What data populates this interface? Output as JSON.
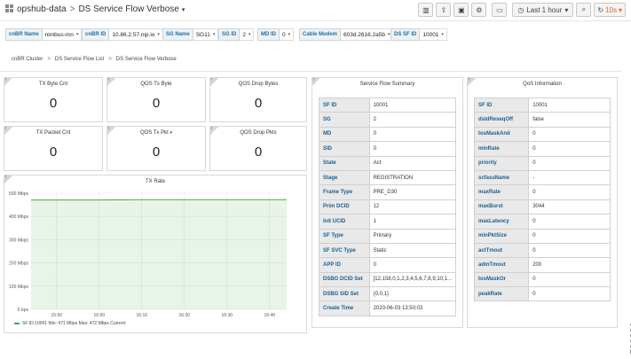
{
  "header": {
    "folder": "opshub-data",
    "dashboard": "DS Service Flow Verbose",
    "tools": [
      {
        "name": "add-panel-icon",
        "glyph": "▥"
      },
      {
        "name": "share-icon",
        "glyph": "⇪"
      },
      {
        "name": "save-icon",
        "glyph": "▣"
      },
      {
        "name": "settings-icon",
        "glyph": "⚙"
      },
      {
        "name": "tv-mode-icon",
        "glyph": "▭"
      }
    ],
    "time_range": "Last 1 hour",
    "refresh": "10s"
  },
  "variables": [
    {
      "label": "cnBR Name",
      "value": "nimbus-mn"
    },
    {
      "label": "cnBR ID",
      "value": "10.86.2.57.nip.io"
    },
    {
      "label": "SG Name",
      "value": "SG11"
    },
    {
      "label": "SG ID",
      "value": "2"
    },
    {
      "label": "MD ID",
      "value": "0"
    },
    {
      "label": "Cable Modem",
      "value": "603d.2616.2a5b"
    },
    {
      "label": "DS SF ID",
      "value": "10001"
    }
  ],
  "links": [
    "cnBR Cluster",
    "DS Service Flow List",
    "DS Service Flow Verbose"
  ],
  "stats": [
    {
      "title": "TX Byte Cnt",
      "value": "0",
      "has_menu": false
    },
    {
      "title": "QOS Tx Byte",
      "value": "0",
      "has_menu": false
    },
    {
      "title": "QOS Drop Bytes",
      "value": "0",
      "has_menu": false
    },
    {
      "title": "TX Packet Cnt",
      "value": "0",
      "has_menu": false
    },
    {
      "title": "QOS Tx Pkt",
      "value": "0",
      "has_menu": true
    },
    {
      "title": "QOS Drop Pkts",
      "value": "0",
      "has_menu": false
    }
  ],
  "summary": {
    "title": "Service Flow Summary",
    "rows": [
      {
        "k": "SF ID",
        "v": "10001"
      },
      {
        "k": "SG",
        "v": "2"
      },
      {
        "k": "MD",
        "v": "0"
      },
      {
        "k": "SID",
        "v": "0"
      },
      {
        "k": "State",
        "v": "Act"
      },
      {
        "k": "Stage",
        "v": "REGISTRATION"
      },
      {
        "k": "Frame Type",
        "v": "PRE_D30"
      },
      {
        "k": "Prim DCID",
        "v": "12"
      },
      {
        "k": "Init UCID",
        "v": "1"
      },
      {
        "k": "SF Type",
        "v": "Primary"
      },
      {
        "k": "SF SVC Type",
        "v": "Static"
      },
      {
        "k": "APP ID",
        "v": "0"
      },
      {
        "k": "DSBG DCID Set",
        "v": "[12,158,0,1,2,3,4,5,6,7,8,9,10,1..."
      },
      {
        "k": "DSBG SID Set",
        "v": "{0,0,1}"
      },
      {
        "k": "Create Time",
        "v": "2020-06-03 13:50:03"
      }
    ]
  },
  "qos": {
    "title": "QoS Information",
    "rows": [
      {
        "k": "SF ID",
        "v": "10001"
      },
      {
        "k": "dsIdReseqOff",
        "v": "false"
      },
      {
        "k": "tosMaskAnd",
        "v": "0"
      },
      {
        "k": "minRate",
        "v": "0"
      },
      {
        "k": "priority",
        "v": "0"
      },
      {
        "k": "scfassName",
        "v": "-"
      },
      {
        "k": "maxRate",
        "v": "0"
      },
      {
        "k": "maxBurst",
        "v": "3044"
      },
      {
        "k": "maxLatency",
        "v": "0"
      },
      {
        "k": "minPktSize",
        "v": "0"
      },
      {
        "k": "actTmout",
        "v": "0"
      },
      {
        "k": "admTmout",
        "v": "200"
      },
      {
        "k": "tosMaskOr",
        "v": "0"
      },
      {
        "k": "peakRate",
        "v": "0"
      }
    ]
  },
  "info_glyph": "i",
  "legend_text": "SF ID:10001  Min: 471 Mbps  Max: 472 Mbps  Current:",
  "figure_code": "520880",
  "chart_data": {
    "type": "area",
    "title": "TX Rate",
    "x_ticks": [
      "15:50",
      "16:00",
      "16:10",
      "16:20",
      "16:30",
      "16:40"
    ],
    "y_ticks": [
      "0 bps",
      "100 Mbps",
      "200 Mbps",
      "300 Mbps",
      "400 Mbps",
      "500 Mbps"
    ],
    "ylim": [
      0,
      500
    ],
    "y_unit": "Mbps",
    "series": [
      {
        "name": "SF ID:10001",
        "color": "#4ea24e",
        "x": [
          "15:44",
          "15:50",
          "16:00",
          "16:10",
          "16:20",
          "16:30",
          "16:40",
          "16:44"
        ],
        "values": [
          471,
          471,
          471,
          472,
          472,
          472,
          472,
          472
        ]
      }
    ]
  }
}
